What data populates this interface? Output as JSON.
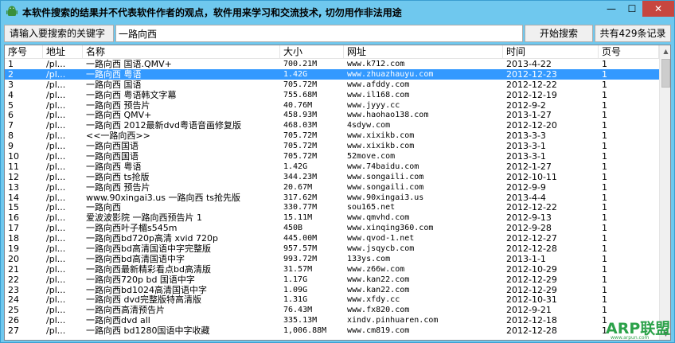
{
  "window": {
    "title": "本软件搜索的结果并不代表软件作者的观点，软件用来学习和交流技术, 切勿用作非法用途",
    "close_glyph": "✕",
    "min_glyph": "—",
    "max_glyph": "☐"
  },
  "toolbar": {
    "search_label": "请输入要搜索的关键字",
    "search_value": "一路向西",
    "start_label": "开始搜索",
    "count_label": "共有429条记录"
  },
  "columns": [
    "序号",
    "地址",
    "名称",
    "大小",
    "网址",
    "时间",
    "页号"
  ],
  "rows": [
    {
      "idx": "1",
      "addr": "/pl...",
      "name": "一路向西 国语.QMV+",
      "size": "700.21M",
      "url": "www.k712.com",
      "time": "2013-4-22",
      "page": "1"
    },
    {
      "idx": "2",
      "addr": "/pl...",
      "name": "一路向西 粤语",
      "size": "1.42G",
      "url": "www.zhuazhauyu.com",
      "time": "2012-12-23",
      "page": "1"
    },
    {
      "idx": "3",
      "addr": "/pl...",
      "name": "一路向西 国语",
      "size": "705.72M",
      "url": "www.afddy.com",
      "time": "2012-12-22",
      "page": "1"
    },
    {
      "idx": "4",
      "addr": "/pl...",
      "name": "一路向西 粤语韩文字幕",
      "size": "755.68M",
      "url": "www.il168.com",
      "time": "2012-12-19",
      "page": "1"
    },
    {
      "idx": "5",
      "addr": "/pl...",
      "name": "一路向西 预告片",
      "size": "40.76M",
      "url": "www.jyyy.cc",
      "time": "2012-9-2",
      "page": "1"
    },
    {
      "idx": "6",
      "addr": "/pl...",
      "name": "一路向西 QMV+",
      "size": "458.93M",
      "url": "www.haohao138.com",
      "time": "2013-1-27",
      "page": "1"
    },
    {
      "idx": "7",
      "addr": "/pl...",
      "name": "一路向西 2012最新dvd粤语音画修复版",
      "size": "468.03M",
      "url": "4sdyw.com",
      "time": "2012-12-20",
      "page": "1"
    },
    {
      "idx": "8",
      "addr": "/pl...",
      "name": "<<一路向西>>",
      "size": "705.72M",
      "url": "www.xixikb.com",
      "time": "2013-3-3",
      "page": "1"
    },
    {
      "idx": "9",
      "addr": "/pl...",
      "name": "一路向西国语",
      "size": "705.72M",
      "url": "www.xixikb.com",
      "time": "2013-3-1",
      "page": "1"
    },
    {
      "idx": "10",
      "addr": "/pl...",
      "name": "一路向西国语",
      "size": "705.72M",
      "url": "52move.com",
      "time": "2013-3-1",
      "page": "1"
    },
    {
      "idx": "11",
      "addr": "/pl...",
      "name": "一路向西 粤语",
      "size": "1.42G",
      "url": "www.74baidu.com",
      "time": "2012-1-27",
      "page": "1"
    },
    {
      "idx": "12",
      "addr": "/pl...",
      "name": "一路向西 ts抢版",
      "size": "344.23M",
      "url": "www.songaili.com",
      "time": "2012-10-11",
      "page": "1"
    },
    {
      "idx": "13",
      "addr": "/pl...",
      "name": "一路向西 预告片",
      "size": "20.67M",
      "url": "www.songaili.com",
      "time": "2012-9-9",
      "page": "1"
    },
    {
      "idx": "14",
      "addr": "/pl...",
      "name": "www.90xingai3.us 一路向西 ts抢先版",
      "size": "317.62M",
      "url": "www.90xingai3.us",
      "time": "2013-4-4",
      "page": "1"
    },
    {
      "idx": "15",
      "addr": "/pl...",
      "name": "一路向西",
      "size": "330.77M",
      "url": "sou165.net",
      "time": "2012-12-22",
      "page": "1"
    },
    {
      "idx": "16",
      "addr": "/pl...",
      "name": "爱波波影院 一路向西预告片 1",
      "size": "15.11M",
      "url": "www.qmvhd.com",
      "time": "2012-9-13",
      "page": "1"
    },
    {
      "idx": "17",
      "addr": "/pl...",
      "name": "一路向西叶子楣s545m",
      "size": "450B",
      "url": "www.xinqing360.com",
      "time": "2012-9-28",
      "page": "1"
    },
    {
      "idx": "18",
      "addr": "/pl...",
      "name": "一路向西bd720p高清 xvid 720p",
      "size": "445.00M",
      "url": "www.qvod-1.net",
      "time": "2012-12-27",
      "page": "1"
    },
    {
      "idx": "19",
      "addr": "/pl...",
      "name": "一路向西bd高清国语中字完整版",
      "size": "957.57M",
      "url": "www.jsqycb.com",
      "time": "2012-12-28",
      "page": "1"
    },
    {
      "idx": "20",
      "addr": "/pl...",
      "name": "一路向西bd高清国语中字",
      "size": "993.72M",
      "url": "133ys.com",
      "time": "2013-1-1",
      "page": "1"
    },
    {
      "idx": "21",
      "addr": "/pl...",
      "name": "一路向西最新精彩看点bd高清版",
      "size": "31.57M",
      "url": "www.z66w.com",
      "time": "2012-10-29",
      "page": "1"
    },
    {
      "idx": "22",
      "addr": "/pl...",
      "name": "一路向西720p bd 国语中字",
      "size": "1.17G",
      "url": "www.kan22.com",
      "time": "2012-12-29",
      "page": "1"
    },
    {
      "idx": "23",
      "addr": "/pl...",
      "name": "一路向西bd1024高清国语中字",
      "size": "1.09G",
      "url": "www.kan22.com",
      "time": "2012-12-29",
      "page": "1"
    },
    {
      "idx": "24",
      "addr": "/pl...",
      "name": "一路向西 dvd完整版特高清版",
      "size": "1.31G",
      "url": "www.xfdy.cc",
      "time": "2012-10-31",
      "page": "1"
    },
    {
      "idx": "25",
      "addr": "/pl...",
      "name": "一路向西高清预告片",
      "size": "76.43M",
      "url": "www.fx820.com",
      "time": "2012-9-21",
      "page": "1"
    },
    {
      "idx": "26",
      "addr": "/pl...",
      "name": "一路向西dvd all",
      "size": "335.13M",
      "url": "xindv.pinhuaren.com",
      "time": "2012-12-18",
      "page": "1"
    },
    {
      "idx": "27",
      "addr": "/pl...",
      "name": "一路向西 bd1280国语中字收藏",
      "size": "1,006.88M",
      "url": "www.cm819.com",
      "time": "2012-12-28",
      "page": "1"
    }
  ],
  "selected_row": 2,
  "watermark": {
    "text": "ARP联盟",
    "sub": "www.arpun.com"
  },
  "colors": {
    "titlebar": "#6fc8ee",
    "selection": "#3399ff",
    "close": "#c7463f",
    "watermark": "#2ca24a"
  }
}
